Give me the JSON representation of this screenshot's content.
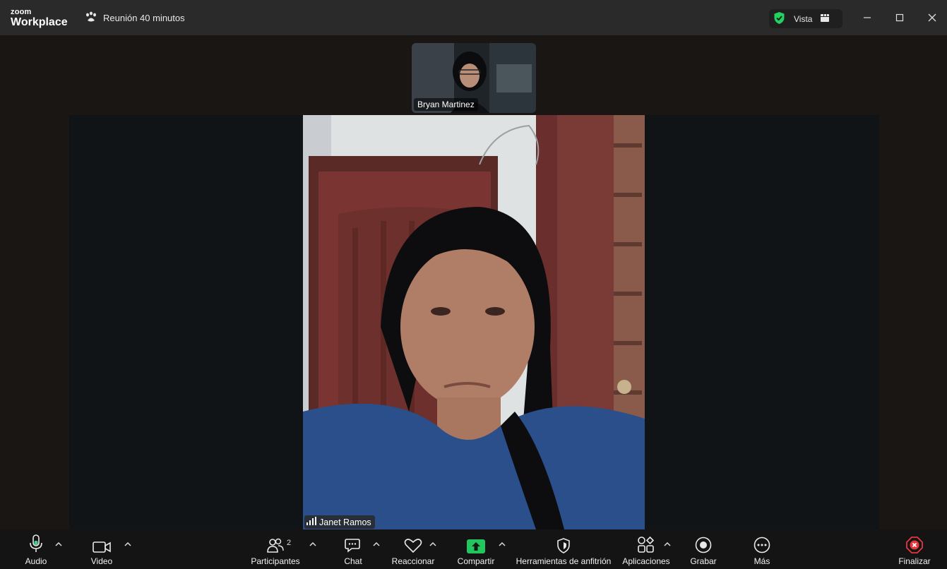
{
  "app": {
    "logo_line1": "zoom",
    "logo_line2": "Workplace"
  },
  "meeting": {
    "title": "Reunión 40 minutos"
  },
  "header": {
    "view_label": "Vista",
    "security_color": "#23d160"
  },
  "participants_video": {
    "thumbnail_name": "Bryan Martinez",
    "main_name": "Janet Ramos"
  },
  "toolbar": {
    "audio": "Audio",
    "video": "Video",
    "participants": "Participantes",
    "participants_count": "2",
    "chat": "Chat",
    "react": "Reaccionar",
    "share": "Compartir",
    "host_tools": "Herramientas de anfitrión",
    "apps": "Aplicaciones",
    "record": "Grabar",
    "more": "Más",
    "end": "Finalizar"
  },
  "colors": {
    "share_green": "#22c55e",
    "end_red": "#e5383b",
    "mic_green": "#3ecf8e"
  }
}
